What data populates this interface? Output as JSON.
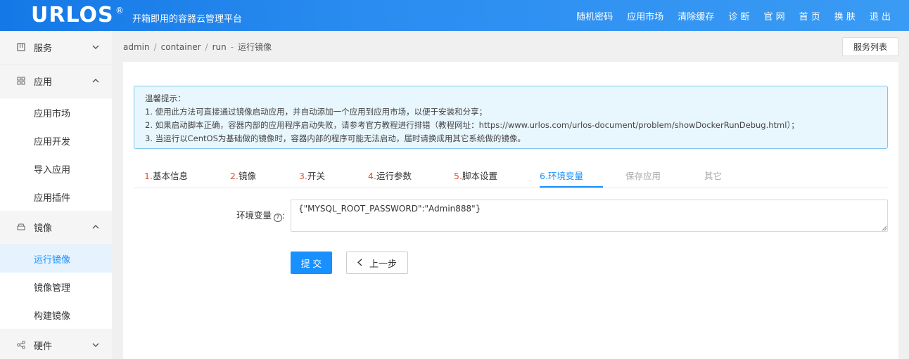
{
  "header": {
    "logo": "URLOS",
    "logo_reg": "®",
    "tagline": "开箱即用的容器云管理平台",
    "nav": [
      "随机密码",
      "应用市场",
      "清除缓存",
      "诊 断",
      "官 网",
      "首 页",
      "换 肤",
      "退 出"
    ]
  },
  "sidebar": {
    "groups": [
      {
        "label": "服务",
        "icon": "grid-icon",
        "expanded": false
      },
      {
        "label": "应用",
        "icon": "apps-icon",
        "expanded": true,
        "items": [
          "应用市场",
          "应用开发",
          "导入应用",
          "应用插件"
        ]
      },
      {
        "label": "镜像",
        "icon": "drive-icon",
        "expanded": true,
        "items": [
          "运行镜像",
          "镜像管理",
          "构建镜像"
        ]
      },
      {
        "label": "硬件",
        "icon": "share-icon",
        "expanded": false
      }
    ],
    "active_item": "运行镜像"
  },
  "breadcrumb": {
    "items": [
      "admin",
      "container",
      "run"
    ],
    "current": "运行镜像"
  },
  "service_list_button": "服务列表",
  "tip": {
    "title": "温馨提示：",
    "lines": [
      "1. 使用此方法可直接通过镜像启动应用，并自动添加一个应用到应用市场，以便于安装和分享；",
      "2. 如果启动脚本正确，容器内部的应用程序启动失败，请参考官方教程进行排错（教程网址：https://www.urlos.com/urlos-document/problem/showDockerRunDebug.html）；",
      "3. 当运行以CentOS为基础做的镜像时，容器内部的程序可能无法启动，届时请换成用其它系统做的镜像。"
    ]
  },
  "tabs": [
    {
      "num": "1.",
      "label": "基本信息"
    },
    {
      "num": "2.",
      "label": "镜像"
    },
    {
      "num": "3.",
      "label": "开关"
    },
    {
      "num": "4.",
      "label": "运行参数"
    },
    {
      "num": "5.",
      "label": "脚本设置"
    },
    {
      "num": "6.",
      "label": "环境变量"
    },
    {
      "num": "",
      "label": "保存应用"
    },
    {
      "num": "",
      "label": "其它"
    }
  ],
  "active_tab": "环境变量",
  "form": {
    "env_label": "环境变量",
    "env_value": "{\"MYSQL_ROOT_PASSWORD\":\"Admin888\"}",
    "submit": "提 交",
    "prev": "上一步"
  },
  "colors": {
    "header_blue": "#1e84ee",
    "accent": "#1890ff",
    "tab_number": "#e0552e",
    "tip_bg": "#e8f6fe",
    "tip_border": "#7cc6ef"
  }
}
